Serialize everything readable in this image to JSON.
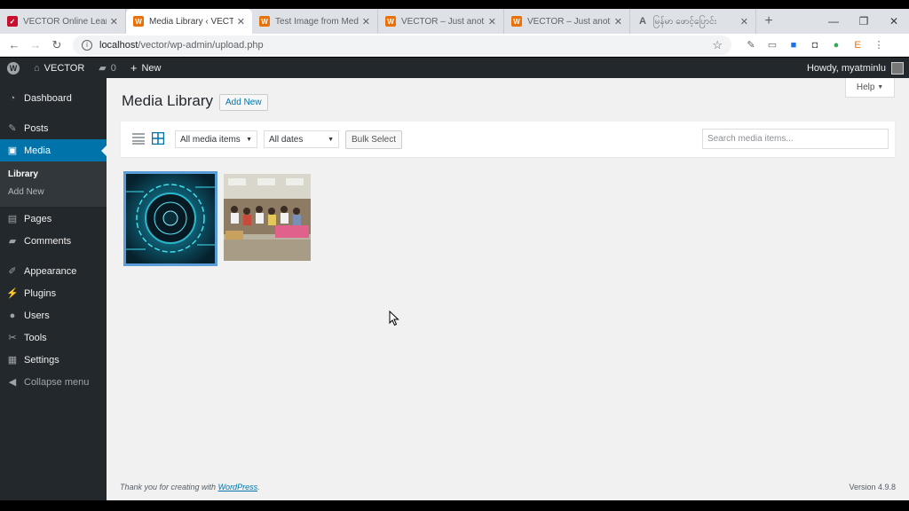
{
  "browser": {
    "tabs": [
      {
        "title": "VECTOR Online Learning",
        "favicon": "v-icon",
        "color": "#c8102e"
      },
      {
        "title": "Media Library ‹ VECTOR",
        "favicon": "wordpress-icon",
        "color": "#e8710a"
      },
      {
        "title": "Test Image from Media",
        "favicon": "wordpress-icon",
        "color": "#e8710a"
      },
      {
        "title": "VECTOR – Just another",
        "favicon": "wordpress-icon",
        "color": "#e8710a"
      },
      {
        "title": "VECTOR – Just another",
        "favicon": "wordpress-icon",
        "color": "#e8710a"
      },
      {
        "title": "မြန်မာ ဖောင့်ပြောင်း",
        "favicon": "a-icon",
        "color": "#5f6368"
      }
    ],
    "url_host": "localhost",
    "url_path": "/vector/wp-admin/upload.php"
  },
  "adminbar": {
    "site_name": "VECTOR",
    "comments_count": "0",
    "new_label": "New",
    "howdy": "Howdy, myatminlu"
  },
  "sidebar": {
    "items": [
      {
        "label": "Dashboard",
        "icon": "dashboard-icon"
      },
      {
        "label": "Posts",
        "icon": "pin-icon"
      },
      {
        "label": "Media",
        "icon": "media-icon"
      },
      {
        "label": "Pages",
        "icon": "pages-icon"
      },
      {
        "label": "Comments",
        "icon": "comment-icon"
      },
      {
        "label": "Appearance",
        "icon": "brush-icon"
      },
      {
        "label": "Plugins",
        "icon": "plug-icon"
      },
      {
        "label": "Users",
        "icon": "user-icon"
      },
      {
        "label": "Tools",
        "icon": "wrench-icon"
      },
      {
        "label": "Settings",
        "icon": "settings-icon"
      }
    ],
    "submenu": [
      "Library",
      "Add New"
    ],
    "collapse": "Collapse menu"
  },
  "main": {
    "help": "Help",
    "title": "Media Library",
    "add_new": "Add New",
    "filter_type": "All media items",
    "filter_date": "All dates",
    "bulk_select": "Bulk Select",
    "search_placeholder": "Search media items...",
    "media": [
      {
        "name": "tech circle image",
        "selected": true
      },
      {
        "name": "group photo in hall",
        "selected": false
      }
    ]
  },
  "footer": {
    "thanks_prefix": "Thank you for creating with ",
    "thanks_link": "WordPress",
    "thanks_suffix": ".",
    "version": "Version 4.9.8"
  }
}
